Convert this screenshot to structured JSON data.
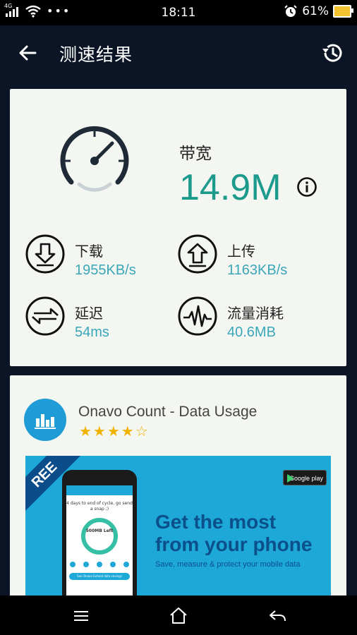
{
  "status_bar": {
    "network": "4G",
    "time": "18:11",
    "battery": "61%"
  },
  "header": {
    "title": "测速结果"
  },
  "result": {
    "bandwidth_label": "带宽",
    "bandwidth_value": "14.9M",
    "stats": [
      {
        "label": "下载",
        "value": "1955KB/s",
        "icon": "download-icon"
      },
      {
        "label": "上传",
        "value": "1163KB/s",
        "icon": "upload-icon"
      },
      {
        "label": "延迟",
        "value": "54ms",
        "icon": "latency-arrows-icon"
      },
      {
        "label": "流量消耗",
        "value": "40.6MB",
        "icon": "pulse-icon"
      }
    ]
  },
  "ad": {
    "app_name": "Onavo Count - Data Usage",
    "rating": 4,
    "stars": "★★★★☆",
    "ribbon": "REE",
    "store_badge": "Google play",
    "headline_line1": "Get the most",
    "headline_line2": "from your phone",
    "subline": "Save, measure & protect your mobile data",
    "phone_text": "4 days to end of cycle, go send a snap ;)",
    "phone_donut": "500MB Left",
    "phone_button": "See Onavo Extend data savings"
  },
  "colors": {
    "accent_teal": "#1c9a8b",
    "value_blue": "#3aa7b8",
    "ad_blue": "#1da8d8",
    "app_bg": "#0c1526"
  }
}
